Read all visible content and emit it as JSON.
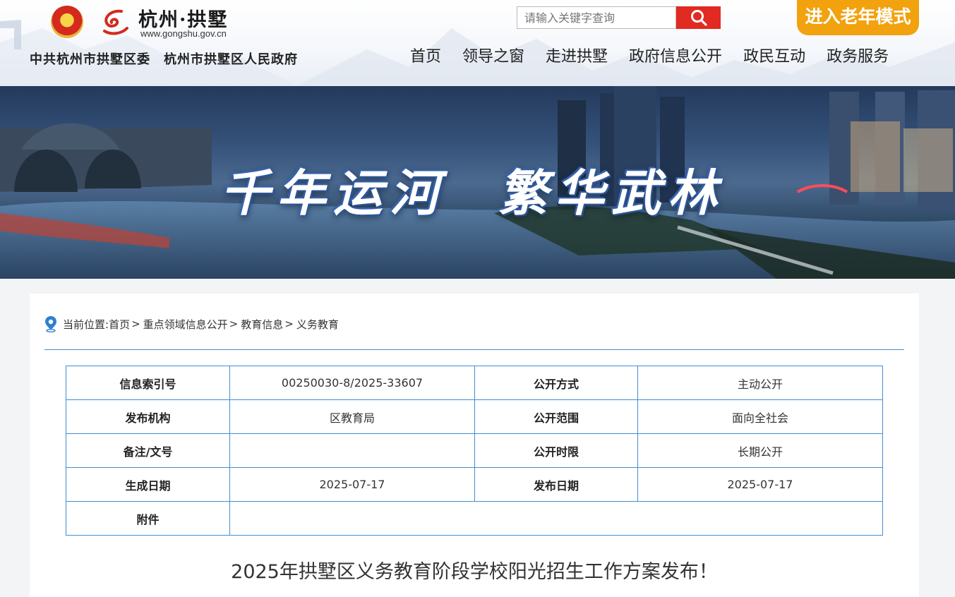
{
  "header": {
    "logo_title": "杭州·拱墅",
    "logo_url": "www.gongshu.gov.cn",
    "org_name": "中共杭州市拱墅区委　杭州市拱墅区人民政府",
    "search_placeholder": "请输入关键字查询",
    "elder_mode_label": "进入老年模式",
    "nav": [
      "首页",
      "领导之窗",
      "走进拱墅",
      "政府信息公开",
      "政民互动",
      "政务服务"
    ]
  },
  "banner": {
    "slogan_left": "千年运河",
    "slogan_right": "繁华武林"
  },
  "breadcrumb": {
    "prefix": "当前位置:",
    "items": [
      "首页",
      "重点领域信息公开",
      "教育信息",
      "义务教育"
    ]
  },
  "meta_table": {
    "rows": [
      {
        "label1": "信息索引号",
        "value1": "00250030-8/2025-33607",
        "label2": "公开方式",
        "value2": "主动公开"
      },
      {
        "label1": "发布机构",
        "value1": "区教育局",
        "label2": "公开范围",
        "value2": "面向全社会"
      },
      {
        "label1": "备注/文号",
        "value1": "",
        "label2": "公开时限",
        "value2": "长期公开"
      },
      {
        "label1": "生成日期",
        "value1": "2025-07-17",
        "label2": "发布日期",
        "value2": "2025-07-17"
      }
    ],
    "attachment_label": "附件",
    "attachment_value": ""
  },
  "article": {
    "title": "2025年拱墅区义务教育阶段学校阳光招生工作方案发布！"
  },
  "colors": {
    "search_button": "#e02a22",
    "elder_button": "#f2a20e",
    "table_border": "#3f8fd2"
  },
  "icons": [
    "national-emblem-icon",
    "gongshu-logo-icon",
    "search-icon",
    "location-pin-icon"
  ]
}
